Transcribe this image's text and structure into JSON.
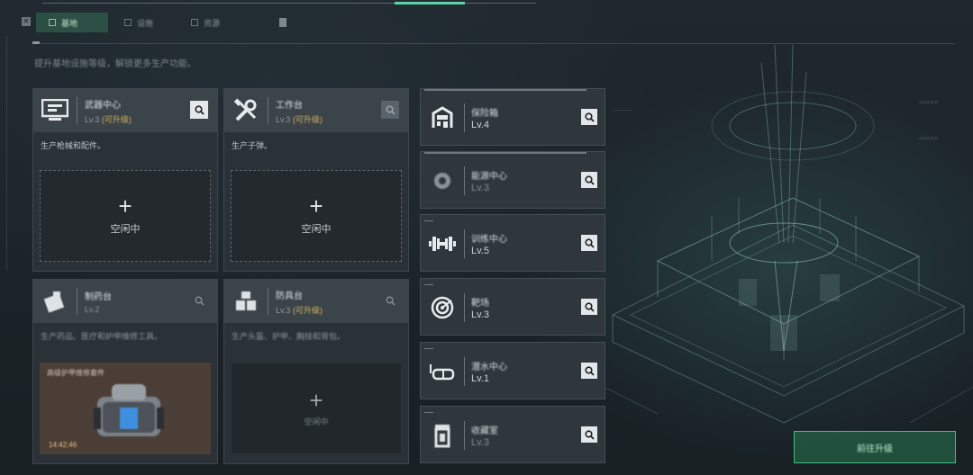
{
  "header": {
    "tabs": [
      {
        "label": "基地",
        "active": true
      },
      {
        "label": "设施",
        "active": false
      },
      {
        "label": "资源",
        "active": false
      }
    ],
    "subtitle": "提升基地设施等级，解锁更多生产功能。"
  },
  "facilities": [
    {
      "name": "武器中心",
      "level": "Lv.3",
      "level_extra": "(可升级)",
      "desc": "生产枪械和配件。",
      "slot_plus": "+",
      "slot_label": "空闲中",
      "icon": "computer-icon"
    },
    {
      "name": "工作台",
      "level": "Lv.3",
      "level_extra": "(可升级)",
      "desc": "生产子弹。",
      "slot_plus": "+",
      "slot_label": "空闲中",
      "icon": "tools-icon"
    },
    {
      "name": "制药台",
      "level": "Lv.2",
      "level_extra": "",
      "desc": "生产药品、医疗和护甲维修工具。",
      "product_name": "高级护甲维修套件",
      "product_count": "14:42:46",
      "icon": "medical-kit-icon"
    },
    {
      "name": "防具台",
      "level": "Lv.3",
      "level_extra": "(可升级)",
      "desc": "生产头盔、护甲、胸挂和背包。",
      "slot_plus": "+",
      "slot_label": "空闲中",
      "icon": "armor-icon"
    }
  ],
  "list": [
    {
      "name": "保险箱",
      "level": "Lv.4",
      "icon": "safe-icon"
    },
    {
      "name": "能源中心",
      "level": "Lv.3",
      "icon": "gear-icon"
    },
    {
      "name": "训练中心",
      "level": "Lv.5",
      "icon": "dumbbell-icon"
    },
    {
      "name": "靶场",
      "level": "Lv.3",
      "icon": "target-icon"
    },
    {
      "name": "潜水中心",
      "level": "Lv.1",
      "icon": "diving-mask-icon"
    },
    {
      "name": "收藏室",
      "level": "Lv.3",
      "icon": "trash-can-icon"
    }
  ],
  "action_button": "前往升级",
  "colors": {
    "accent": "#5fd1a4",
    "gold": "#d6b560",
    "card": "#2a3237",
    "card_head": "#3b4449"
  }
}
